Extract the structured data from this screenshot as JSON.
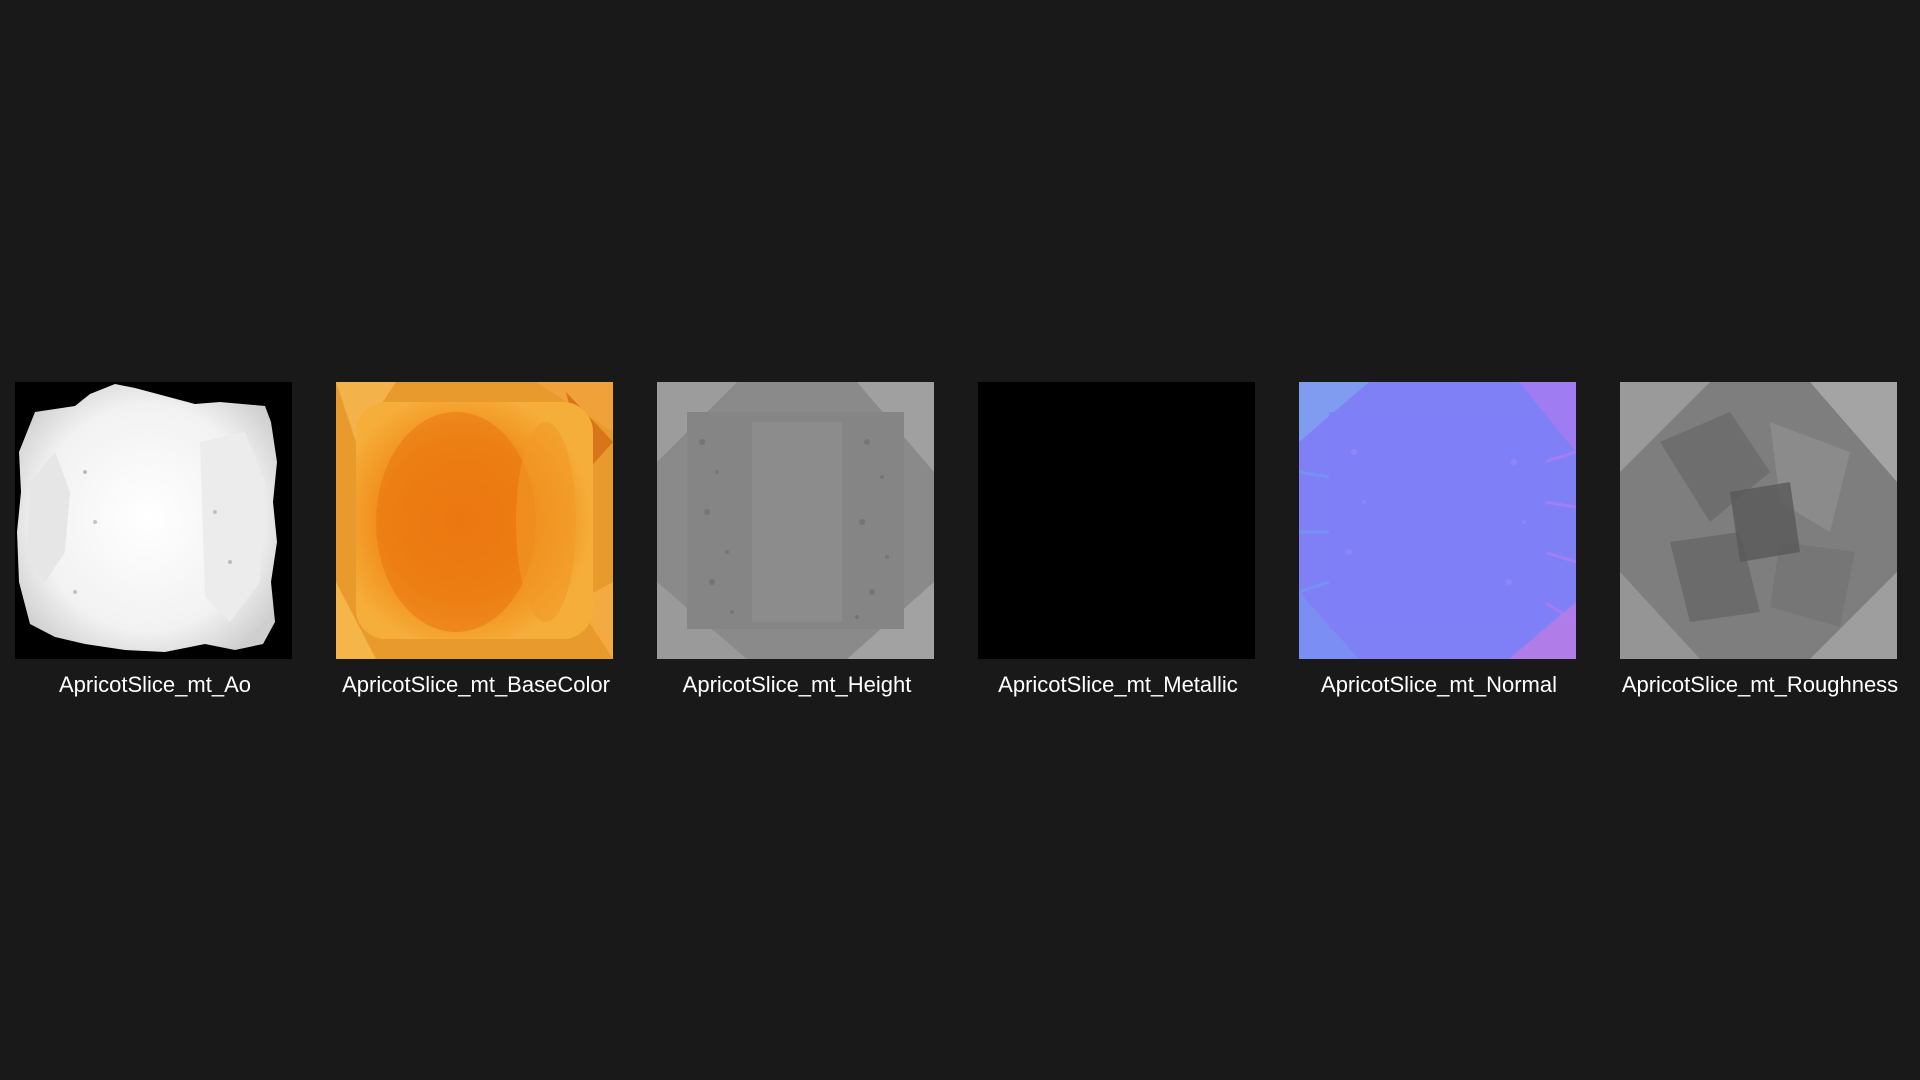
{
  "files": [
    {
      "name": "ApricotSlice_mt_Ao",
      "thumbnail": "ambient-occlusion-map"
    },
    {
      "name": "ApricotSlice_mt_BaseColor",
      "thumbnail": "base-color-map"
    },
    {
      "name": "ApricotSlice_mt_Height",
      "thumbnail": "height-map"
    },
    {
      "name": "ApricotSlice_mt_Metallic",
      "thumbnail": "metallic-map"
    },
    {
      "name": "ApricotSlice_mt_Normal",
      "thumbnail": "normal-map"
    },
    {
      "name": "ApricotSlice_mt_Roughness",
      "thumbnail": "roughness-map"
    }
  ],
  "colors": {
    "background": "#191919",
    "label": "#ffffff"
  }
}
